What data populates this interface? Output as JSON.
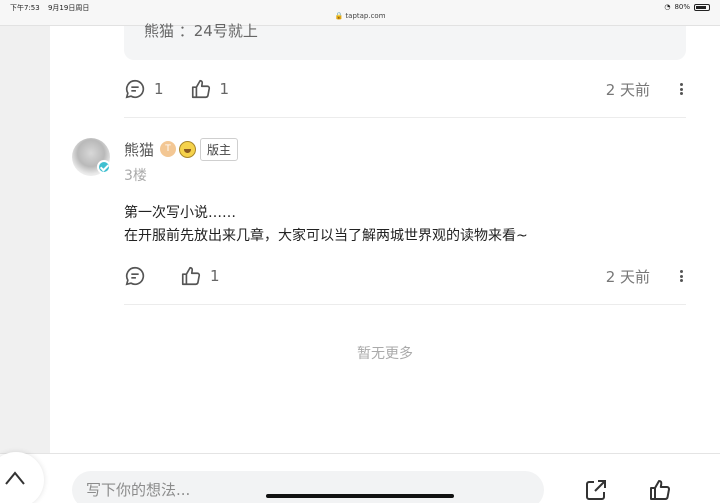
{
  "status_bar": {
    "time": "下午7:53",
    "date": "9月19日周日",
    "url": "taptap.com",
    "battery": "80%",
    "battery_level": 0.8
  },
  "quoted_reply": {
    "text": "熊猫 ：24号就上"
  },
  "first_actions": {
    "comment_count": "1",
    "like_count": "1",
    "time": "2 天前"
  },
  "reply": {
    "username": "熊猫",
    "level_badge": "T",
    "role": "版主",
    "floor": "3楼",
    "lines": [
      "第一次写小说……",
      "在开服前先放出来几章，大家可以当了解两城世界观的读物来看~"
    ],
    "like_count": "1",
    "time": "2 天前"
  },
  "no_more_text": "暂无更多",
  "bottom_bar": {
    "input_placeholder": "写下你的想法..."
  },
  "icons": {
    "comment": "comment-icon",
    "like": "thumbs-up-icon",
    "more": "more-vertical-icon",
    "share": "share-icon",
    "scroll_top": "chevron-up-icon",
    "verified": "verified-badge-icon"
  },
  "colors": {
    "accent_verified": "#3fbfd0",
    "muted_text": "#aaaaaa"
  }
}
